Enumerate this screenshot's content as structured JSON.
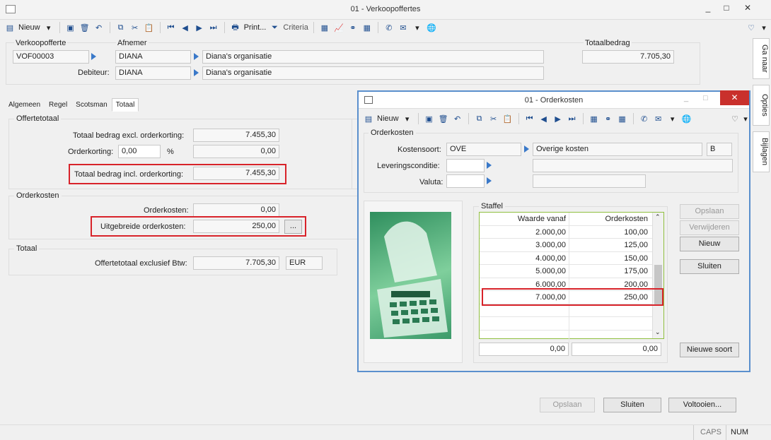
{
  "window": {
    "title": "01 - Verkoopoffertes"
  },
  "toolbar": {
    "new_label": "Nieuw",
    "print_label": "Print...",
    "criteria_label": "Criteria"
  },
  "side_tabs": [
    "Ga naar",
    "Opties",
    "Bijlagen"
  ],
  "header": {
    "verkoopofferte_label": "Verkoopofferte",
    "verkoopofferte_value": "VOF00003",
    "afnemer_label": "Afnemer",
    "afnemer_code": "DIANA",
    "afnemer_name": "Diana's organisatie",
    "debiteur_label": "Debiteur:",
    "debiteur_code": "DIANA",
    "debiteur_name": "Diana's organisatie",
    "totaalbedrag_label": "Totaalbedrag",
    "totaalbedrag_value": "7.705,30"
  },
  "tabs": [
    "Algemeen",
    "Regel",
    "Scotsman",
    "Totaal"
  ],
  "offertetotaal": {
    "title": "Offertetotaal",
    "excl_label": "Totaal bedrag excl. orderkorting:",
    "excl_value": "7.455,30",
    "korting_label": "Orderkorting:",
    "korting_pct": "0,00",
    "pct_sign": "%",
    "korting_value": "0,00",
    "incl_label": "Totaal bedrag incl. orderkorting:",
    "incl_value": "7.455,30"
  },
  "orderkosten": {
    "title": "Orderkosten",
    "kosten_label": "Orderkosten:",
    "kosten_value": "0,00",
    "uitgebreide_label": "Uitgebreide orderkosten:",
    "uitgebreide_value": "250,00",
    "ellipsis": "..."
  },
  "totaal": {
    "title": "Totaal",
    "excl_btw_label": "Offertetotaal exclusief Btw:",
    "excl_btw_value": "7.705,30",
    "currency": "EUR"
  },
  "footer_buttons": {
    "opslaan": "Opslaan",
    "sluiten": "Sluiten",
    "voltooien": "Voltooien..."
  },
  "status": {
    "caps": "CAPS",
    "num": "NUM"
  },
  "dialog": {
    "title": "01 - Orderkosten",
    "new_label": "Nieuw",
    "group_title": "Orderkosten",
    "kostensoort_label": "Kostensoort:",
    "kostensoort_code": "OVE",
    "kostensoort_name": "Overige kosten",
    "kostensoort_extra": "B",
    "leveringsconditie_label": "Leveringsconditie:",
    "valuta_label": "Valuta:",
    "staffel_title": "Staffel",
    "col_waarde": "Waarde vanaf",
    "col_kosten": "Orderkosten",
    "rows": [
      {
        "waarde": "2.000,00",
        "kosten": "100,00"
      },
      {
        "waarde": "3.000,00",
        "kosten": "125,00"
      },
      {
        "waarde": "4.000,00",
        "kosten": "150,00"
      },
      {
        "waarde": "5.000,00",
        "kosten": "175,00"
      },
      {
        "waarde": "6.000,00",
        "kosten": "200,00"
      },
      {
        "waarde": "7.000,00",
        "kosten": "250,00"
      }
    ],
    "total_waarde": "0,00",
    "total_kosten": "0,00",
    "buttons": {
      "opslaan": "Opslaan",
      "verwijderen": "Verwijderen",
      "nieuw": "Nieuw",
      "sluiten": "Sluiten",
      "nieuwe_soort": "Nieuwe soort"
    }
  }
}
